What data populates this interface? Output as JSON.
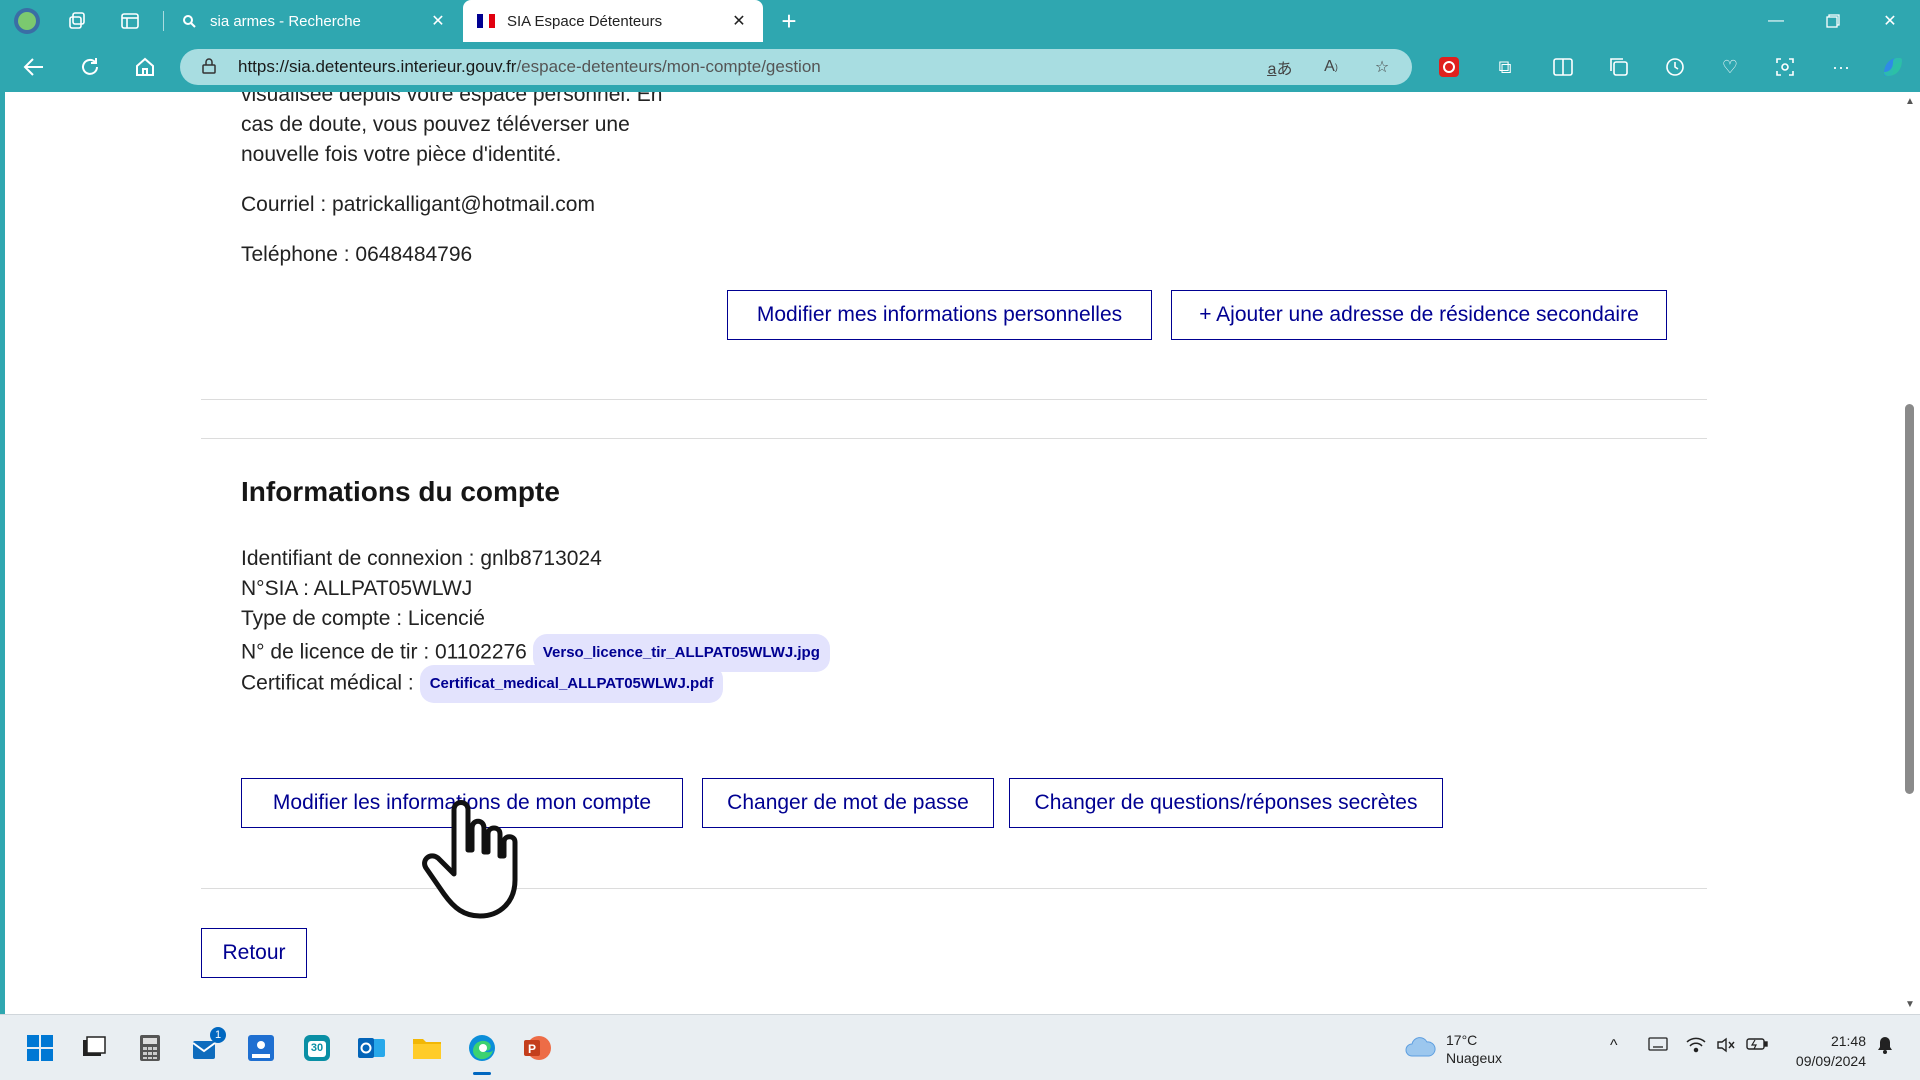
{
  "browser": {
    "tabs": [
      {
        "title": "sia armes - Recherche",
        "icon": "search-icon"
      },
      {
        "title": "SIA Espace Détenteurs",
        "icon": "marianne-icon"
      }
    ],
    "address": {
      "host": "https://sia.detenteurs.interieur.gouv.fr",
      "path": "/espace-detenteurs/mon-compte/gestion"
    }
  },
  "page": {
    "intro_lines": [
      "visualisée depuis votre espace personnel. En",
      "cas de doute, vous pouvez téléverser une",
      "nouvelle fois votre pièce d'identité."
    ],
    "email_line": "Courriel : patrickalligant@hotmail.com",
    "phone_line": "Teléphone : 0648484796",
    "btn_modify_personal": "Modifier mes informations personnelles",
    "btn_add_address": "+ Ajouter une adresse de résidence secondaire",
    "account_title": "Informations du compte",
    "login_id": "Identifiant de connexion : gnlb8713024",
    "sia_number": "N°SIA : ALLPAT05WLWJ",
    "account_type": "Type de compte : Licencié",
    "license_line": "N° de licence de tir : 01102276",
    "license_file": "Verso_licence_tir_ALLPAT05WLWJ.jpg",
    "medical_line": "Certificat médical :",
    "medical_file": "Certificat_medical_ALLPAT05WLWJ.pdf",
    "btn_modify_account": "Modifier les informations de mon compte",
    "btn_change_password": "Changer de mot de passe",
    "btn_change_questions": "Changer de questions/réponses secrètes",
    "btn_back": "Retour"
  },
  "taskbar": {
    "temperature": "17°C",
    "weather": "Nuageux",
    "time": "21:48",
    "date": "09/09/2024",
    "mail_badge": "1",
    "calendar_day": "30"
  }
}
